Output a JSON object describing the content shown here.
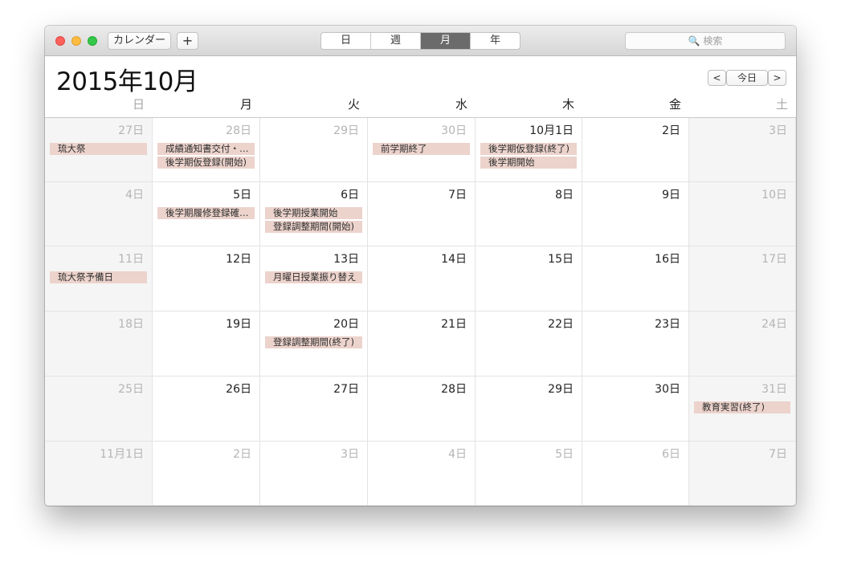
{
  "toolbar": {
    "calendars_label": "カレンダー",
    "add_label": "+",
    "view_tabs": [
      "日",
      "週",
      "月",
      "年"
    ],
    "active_view": "月",
    "search_placeholder": "🔍 検索"
  },
  "header": {
    "month_title": "2015年10月",
    "prev_label": "<",
    "today_label": "今日",
    "next_label": ">"
  },
  "weekdays": [
    "日",
    "月",
    "火",
    "水",
    "木",
    "金",
    "土"
  ],
  "weeks": [
    [
      {
        "label": "27日",
        "muted": true,
        "events": [
          "琉大祭"
        ]
      },
      {
        "label": "28日",
        "muted": true,
        "events": [
          "成績通知書交付・…",
          "後学期仮登録(開始)"
        ]
      },
      {
        "label": "29日",
        "muted": true,
        "events": []
      },
      {
        "label": "30日",
        "muted": true,
        "events": [
          "前学期終了"
        ]
      },
      {
        "label": "10月1日",
        "muted": false,
        "events": [
          "後学期仮登録(終了)",
          "後学期開始"
        ]
      },
      {
        "label": "2日",
        "muted": false,
        "events": []
      },
      {
        "label": "3日",
        "muted": true,
        "events": []
      }
    ],
    [
      {
        "label": "4日",
        "muted": true,
        "events": []
      },
      {
        "label": "5日",
        "muted": false,
        "events": [
          "後学期履修登録確…"
        ]
      },
      {
        "label": "6日",
        "muted": false,
        "events": [
          "後学期授業開始",
          "登録調整期間(開始)"
        ]
      },
      {
        "label": "7日",
        "muted": false,
        "events": []
      },
      {
        "label": "8日",
        "muted": false,
        "events": []
      },
      {
        "label": "9日",
        "muted": false,
        "events": []
      },
      {
        "label": "10日",
        "muted": true,
        "events": []
      }
    ],
    [
      {
        "label": "11日",
        "muted": true,
        "events": [
          "琉大祭予備日"
        ]
      },
      {
        "label": "12日",
        "muted": false,
        "events": []
      },
      {
        "label": "13日",
        "muted": false,
        "events": [
          "月曜日授業振り替え"
        ]
      },
      {
        "label": "14日",
        "muted": false,
        "events": []
      },
      {
        "label": "15日",
        "muted": false,
        "events": []
      },
      {
        "label": "16日",
        "muted": false,
        "events": []
      },
      {
        "label": "17日",
        "muted": true,
        "events": []
      }
    ],
    [
      {
        "label": "18日",
        "muted": true,
        "events": []
      },
      {
        "label": "19日",
        "muted": false,
        "events": []
      },
      {
        "label": "20日",
        "muted": false,
        "events": [
          "登録調整期間(終了)"
        ]
      },
      {
        "label": "21日",
        "muted": false,
        "events": []
      },
      {
        "label": "22日",
        "muted": false,
        "events": []
      },
      {
        "label": "23日",
        "muted": false,
        "events": []
      },
      {
        "label": "24日",
        "muted": true,
        "events": []
      }
    ],
    [
      {
        "label": "25日",
        "muted": true,
        "events": []
      },
      {
        "label": "26日",
        "muted": false,
        "events": []
      },
      {
        "label": "27日",
        "muted": false,
        "events": []
      },
      {
        "label": "28日",
        "muted": false,
        "events": []
      },
      {
        "label": "29日",
        "muted": false,
        "events": []
      },
      {
        "label": "30日",
        "muted": false,
        "events": []
      },
      {
        "label": "31日",
        "muted": true,
        "events": [
          "教育実習(終了)"
        ]
      }
    ],
    [
      {
        "label": "11月1日",
        "muted": true,
        "events": []
      },
      {
        "label": "2日",
        "muted": true,
        "events": []
      },
      {
        "label": "3日",
        "muted": true,
        "events": []
      },
      {
        "label": "4日",
        "muted": true,
        "events": []
      },
      {
        "label": "5日",
        "muted": true,
        "events": []
      },
      {
        "label": "6日",
        "muted": true,
        "events": []
      },
      {
        "label": "7日",
        "muted": true,
        "events": []
      }
    ]
  ],
  "colors": {
    "event_fill": "#ecd3cc",
    "weekend_fill": "#f5f5f5",
    "active_tab": "#6b6b6b",
    "close": "#fc605c",
    "minimize": "#fdbc40",
    "zoom": "#34c84a"
  }
}
